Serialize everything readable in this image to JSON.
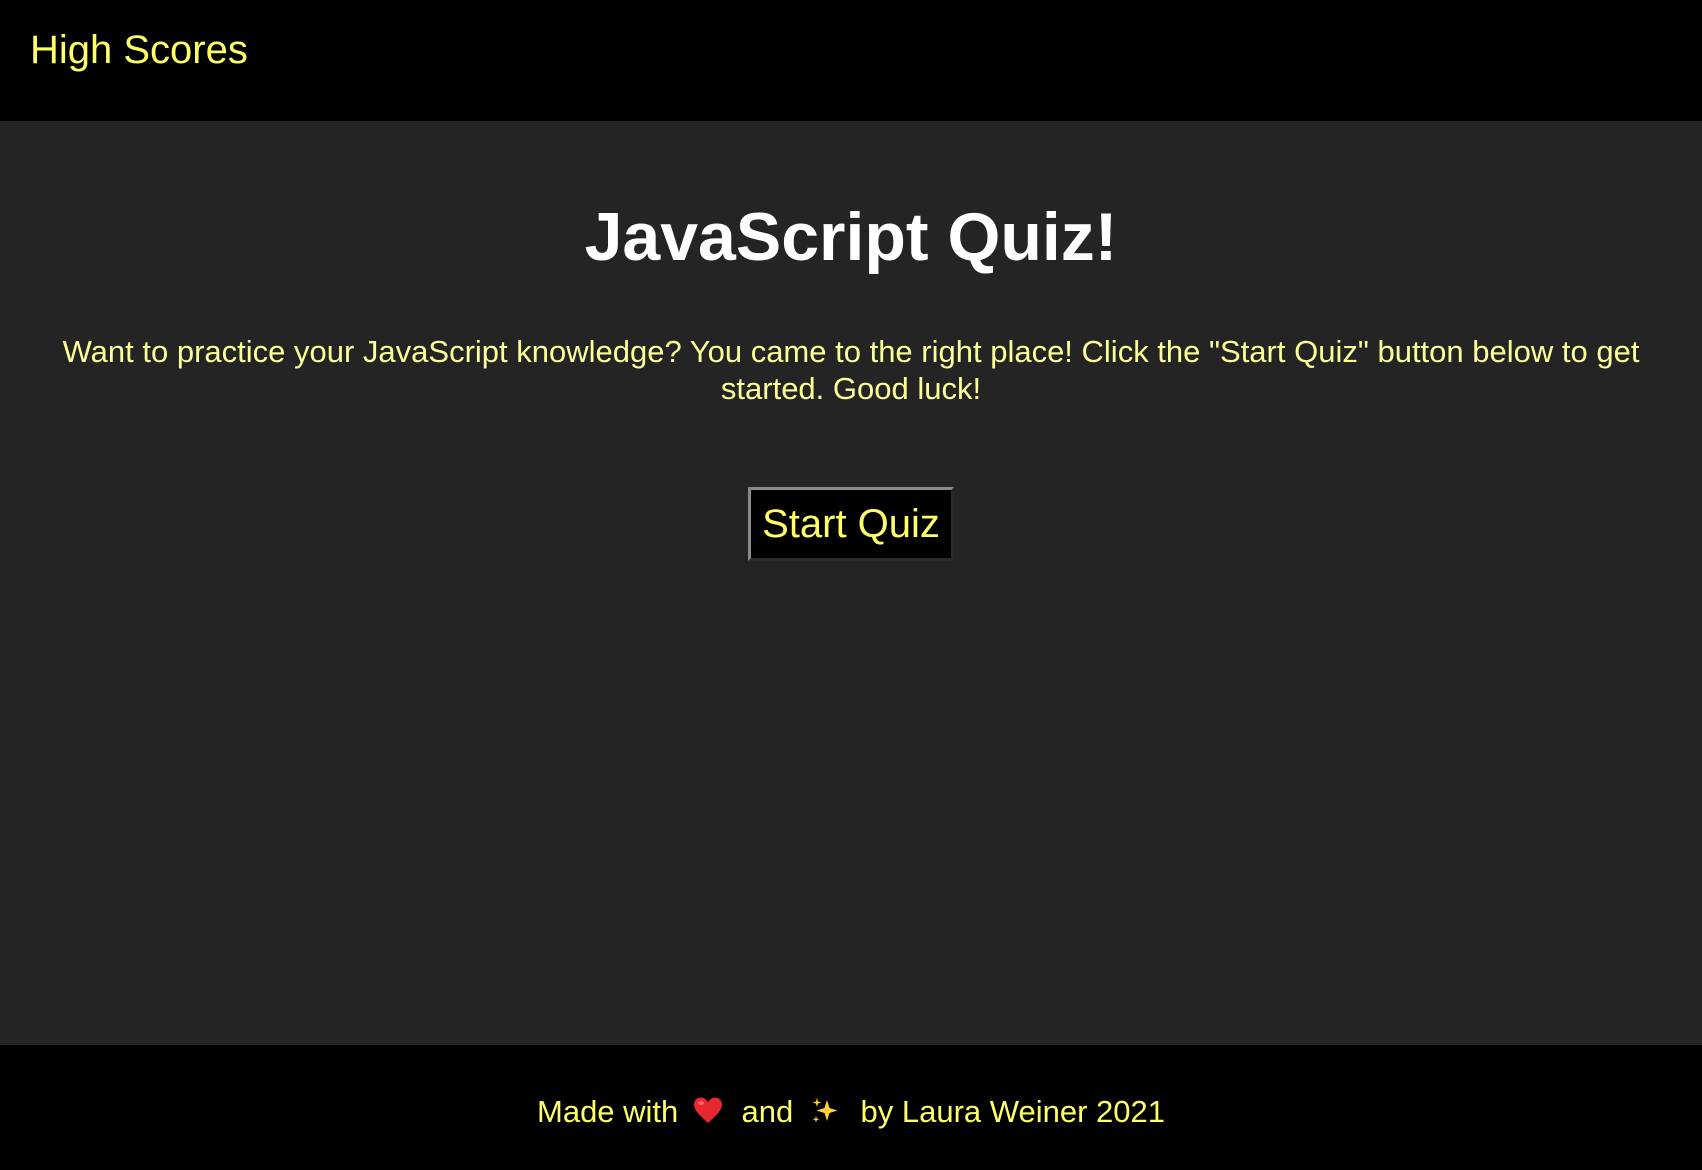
{
  "header": {
    "high_scores_label": "High Scores"
  },
  "main": {
    "title": "JavaScript Quiz!",
    "intro": "Want to practice your JavaScript knowledge? You came to the right place! Click the \"Start Quiz\" button below to get started. Good luck!",
    "start_button_label": "Start Quiz"
  },
  "footer": {
    "made_with": "Made with",
    "and": "and",
    "byline": "by Laura Weiner 2021",
    "heart_icon": "heart-icon",
    "sparkle_icon": "sparkle-icon"
  },
  "colors": {
    "page_background": "#242424",
    "bar_background": "#000000",
    "accent_yellow": "#ffff66",
    "intro_yellow": "#ffff99",
    "title_white": "#ffffff"
  }
}
